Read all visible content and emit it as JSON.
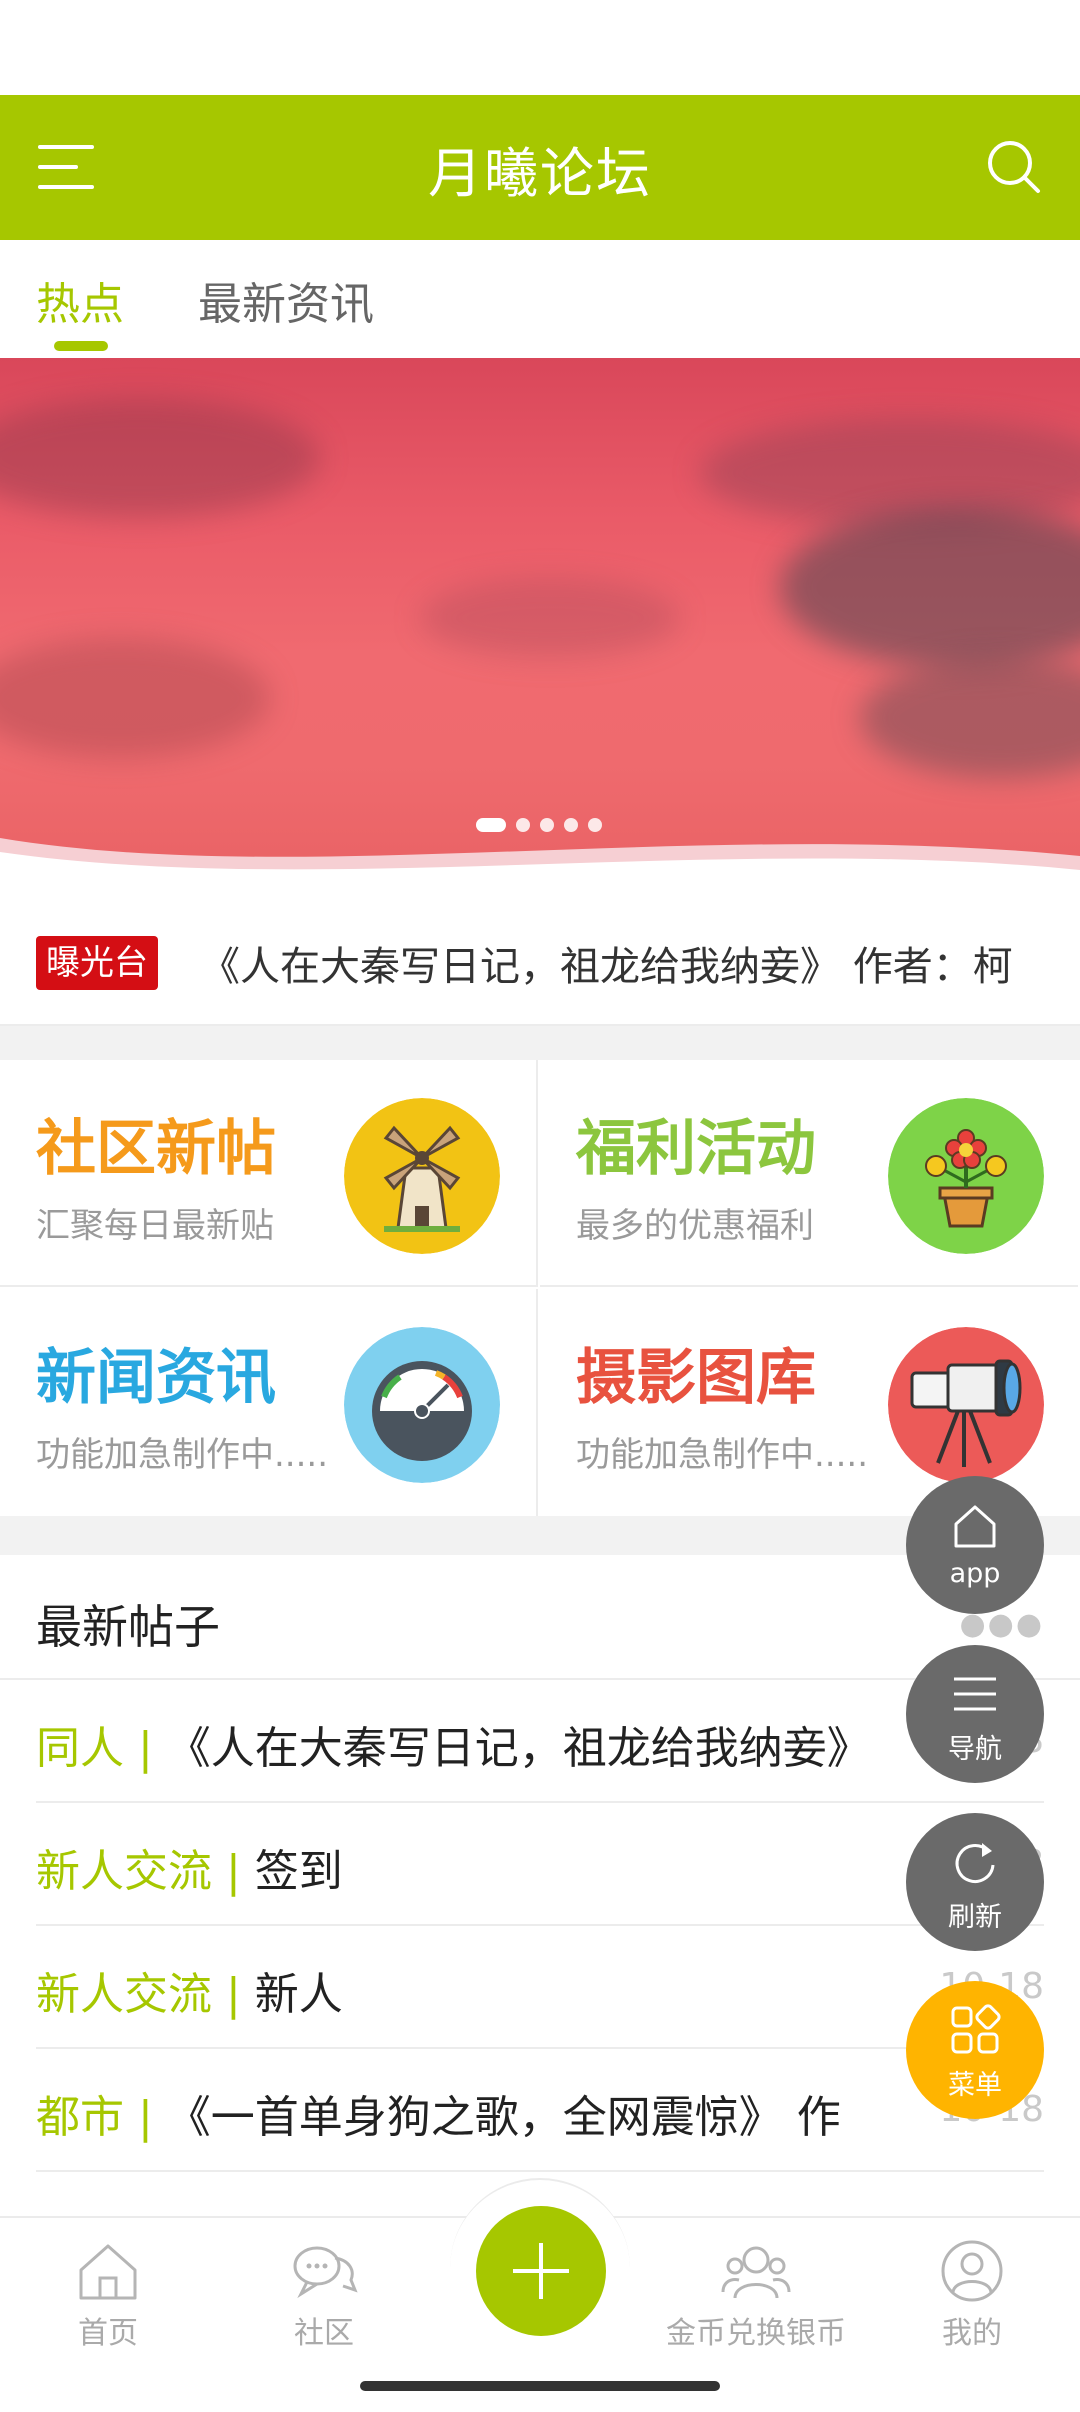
{
  "app": {
    "title": "月曦论坛",
    "accent_color": "#a6c700"
  },
  "header": {
    "menu_icon": "hamburger-icon",
    "search_icon": "search-icon"
  },
  "tabs": [
    {
      "label": "热点",
      "active": true
    },
    {
      "label": "最新资讯",
      "active": false
    }
  ],
  "banner": {
    "slide_count": 5,
    "active_slide": 1
  },
  "notice": {
    "badge": "曝光台",
    "text": "《人在大秦写日记，祖龙给我纳妾》 作者：柯"
  },
  "features": [
    {
      "title": "社区新帖",
      "subtitle": "汇聚每日最新贴",
      "color": "#f59a1b",
      "icon": "windmill-icon"
    },
    {
      "title": "福利活动",
      "subtitle": "最多的优惠福利",
      "color": "#8cc63e",
      "icon": "flower-pot-icon"
    },
    {
      "title": "新闻资讯",
      "subtitle": "功能加急制作中.....",
      "color": "#29a8e0",
      "icon": "speedometer-icon"
    },
    {
      "title": "摄影图库",
      "subtitle": "功能加急制作中.....",
      "color": "#e8523f",
      "icon": "camera-tripod-icon"
    }
  ],
  "latest": {
    "title": "最新帖子",
    "more": "●●●",
    "posts": [
      {
        "tag": "同人 | ",
        "title": "《人在大秦写日记，祖龙给我纳妾》",
        "date": "10-18"
      },
      {
        "tag": "新人交流 | ",
        "title": "签到",
        "date": "10-18"
      },
      {
        "tag": "新人交流 | ",
        "title": "新人",
        "date": "10-18"
      },
      {
        "tag": "都市 | ",
        "title": "《一首单身狗之歌，全网震惊》 作",
        "date": "10-18"
      }
    ]
  },
  "floating_buttons": [
    {
      "label": "app",
      "icon": "home-outline-icon"
    },
    {
      "label": "导航",
      "icon": "list-icon"
    },
    {
      "label": "刷新",
      "icon": "refresh-icon"
    },
    {
      "label": "菜单",
      "icon": "grid-menu-icon"
    }
  ],
  "bottom_nav": [
    {
      "label": "首页",
      "icon": "home-icon"
    },
    {
      "label": "社区",
      "icon": "chat-bubbles-icon"
    },
    {
      "label": "",
      "icon": "plus-icon"
    },
    {
      "label": "金币兑换银币",
      "icon": "users-icon"
    },
    {
      "label": "我的",
      "icon": "user-icon"
    }
  ]
}
